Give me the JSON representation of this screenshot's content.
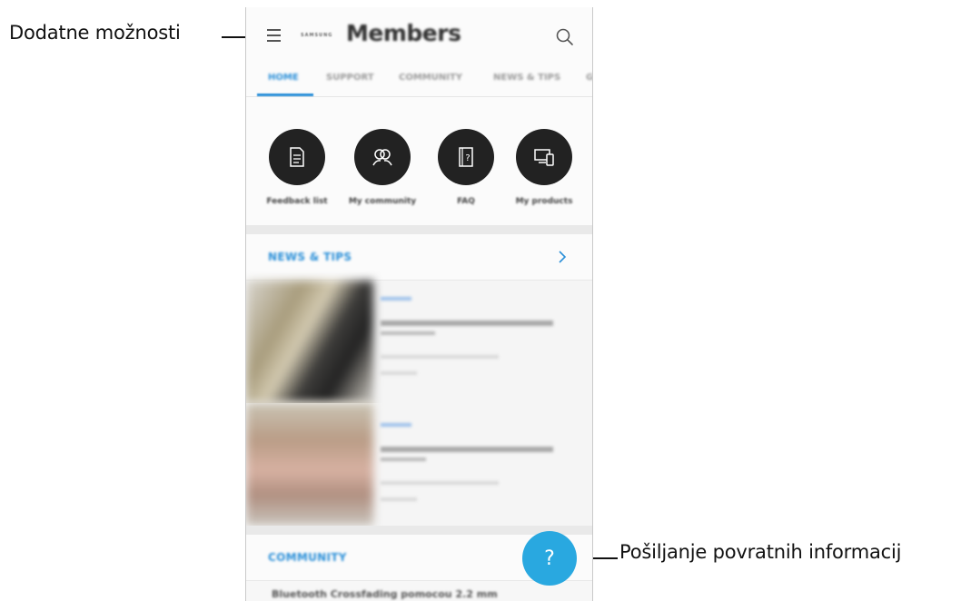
{
  "callouts": {
    "left": "Dodatne možnosti",
    "right": "Pošiljanje povratnih informacij"
  },
  "appbar": {
    "brand_small": "SAMSUNG",
    "brand": "Members",
    "menu_icon": "hamburger-menu-icon",
    "search_icon": "search-icon"
  },
  "tabs": [
    {
      "label": "HOME",
      "active": true
    },
    {
      "label": "SUPPORT",
      "active": false
    },
    {
      "label": "COMMUNITY",
      "active": false
    },
    {
      "label": "NEWS & TIPS",
      "active": false
    },
    {
      "label": "G",
      "active": false
    }
  ],
  "shortcuts": [
    {
      "label": "Feedback list",
      "icon": "document-icon"
    },
    {
      "label": "My community",
      "icon": "community-icon"
    },
    {
      "label": "FAQ",
      "icon": "faq-icon"
    },
    {
      "label": "My products",
      "icon": "devices-icon"
    }
  ],
  "news_section": {
    "title": "NEWS & TIPS"
  },
  "community_section": {
    "title": "COMMUNITY",
    "preview_text": "Bluetooth Crossfading pomocou 2.2 mm"
  },
  "fab": {
    "symbol": "?",
    "accent": "#29a8e0"
  },
  "colors": {
    "accent_blue": "#2a8fd8",
    "circle_dark": "#222222"
  }
}
